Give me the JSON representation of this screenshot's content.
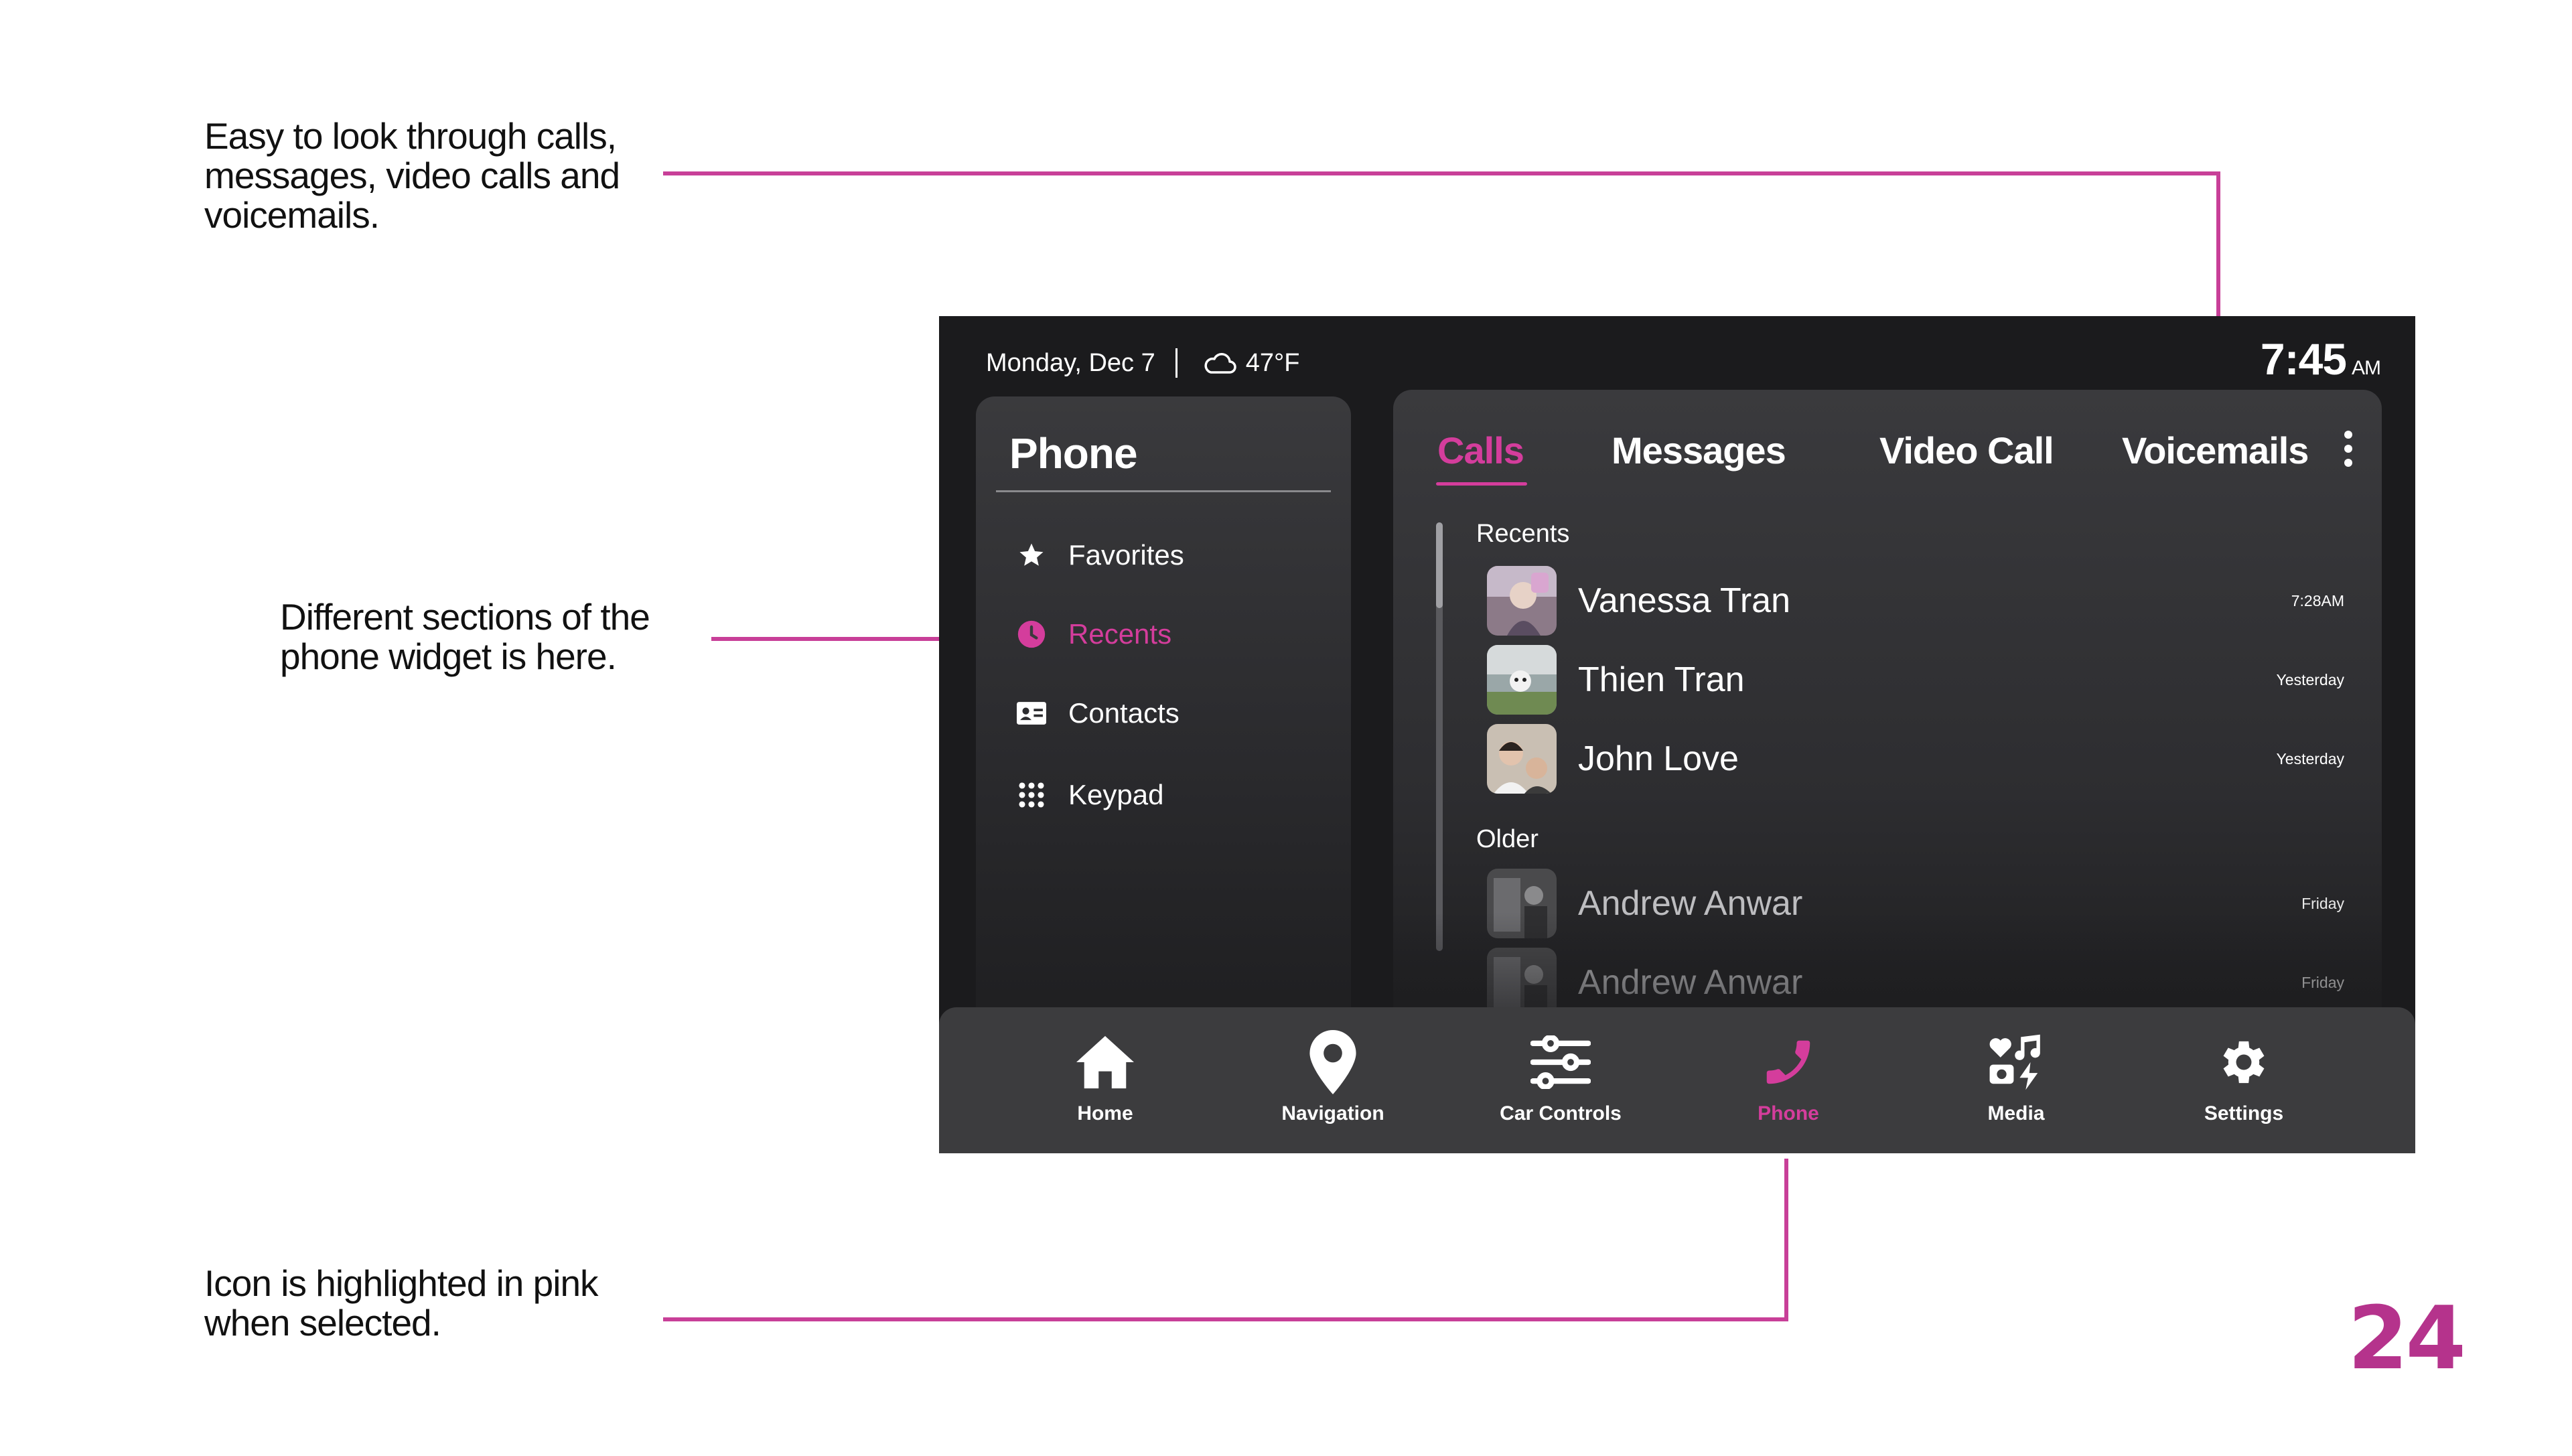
{
  "annotations": {
    "top": "Easy to look through calls,\nmessages, video calls and\nvoicemails.",
    "middle": "Different sections of the\nphone widget is here.",
    "bottom": "Icon is highlighted in pink\nwhen selected."
  },
  "page_number": "24",
  "status": {
    "date": "Monday, Dec 7",
    "weather_icon": "cloud-icon",
    "temperature": "47°F",
    "time": "7:45",
    "ampm": "AM"
  },
  "sidebar": {
    "title": "Phone",
    "items": [
      {
        "label": "Favorites",
        "icon": "star-icon"
      },
      {
        "label": "Recents",
        "icon": "clock-icon",
        "active": true
      },
      {
        "label": "Contacts",
        "icon": "contact-card-icon"
      },
      {
        "label": "Keypad",
        "icon": "keypad-icon"
      }
    ]
  },
  "tabs": [
    {
      "label": "Calls",
      "active": true
    },
    {
      "label": "Messages"
    },
    {
      "label": "Video Call"
    },
    {
      "label": "Voicemails"
    }
  ],
  "calls": {
    "recents_label": "Recents",
    "older_label": "Older",
    "recents": [
      {
        "name": "Vanessa Tran",
        "time": "7:28AM"
      },
      {
        "name": "Thien Tran",
        "time": "Yesterday"
      },
      {
        "name": "John Love",
        "time": "Yesterday"
      }
    ],
    "older": [
      {
        "name": "Andrew Anwar",
        "time": "Friday"
      },
      {
        "name": "Andrew Anwar",
        "time": "Friday"
      }
    ]
  },
  "bottom_nav": [
    {
      "label": "Home",
      "icon": "home-icon"
    },
    {
      "label": "Navigation",
      "icon": "location-pin-icon"
    },
    {
      "label": "Car Controls",
      "icon": "sliders-icon"
    },
    {
      "label": "Phone",
      "icon": "phone-icon",
      "active": true
    },
    {
      "label": "Media",
      "icon": "media-icon"
    },
    {
      "label": "Settings",
      "icon": "gear-icon"
    }
  ],
  "colors": {
    "accent": "#d43d9c",
    "annotation_line": "#c83f98",
    "page_number": "#b5338c",
    "screen_bg": "#1b1b1d"
  }
}
